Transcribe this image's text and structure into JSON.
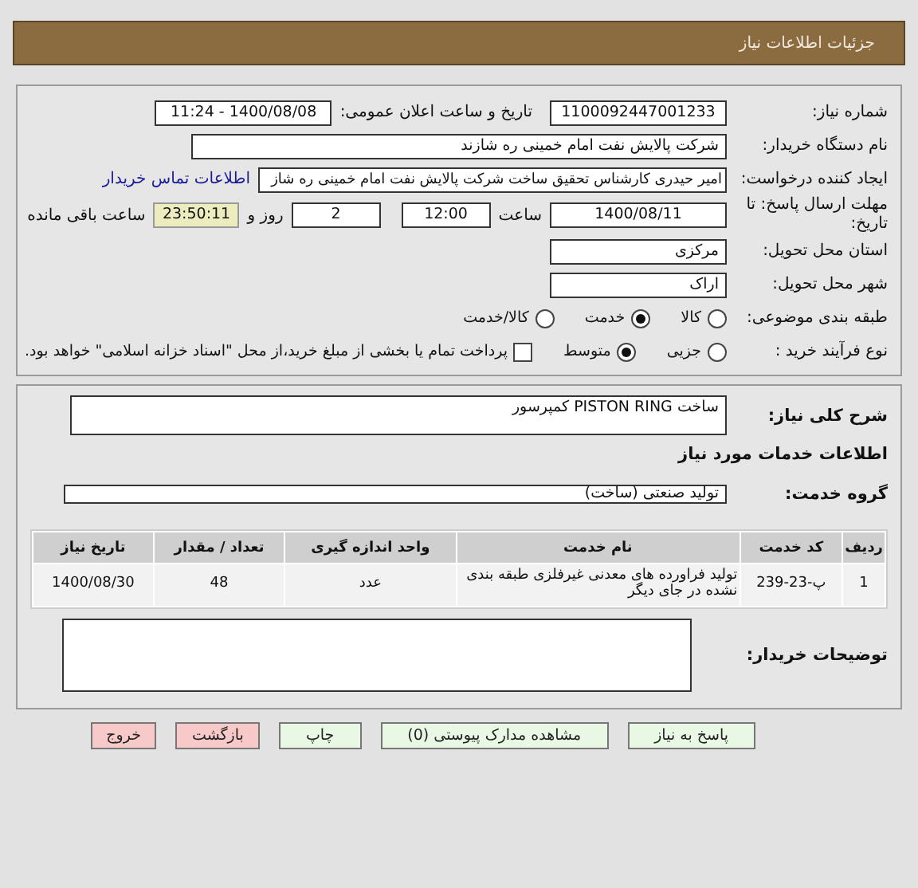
{
  "header": {
    "title": "جزئیات اطلاعات نیاز"
  },
  "need_number": {
    "label": "شماره نیاز:",
    "value": "1100092447001233"
  },
  "announce": {
    "label": "تاریخ و ساعت اعلان عمومی:",
    "value": "1400/08/08 - 11:24"
  },
  "buyer": {
    "label": "نام دستگاه خریدار:",
    "value": "شرکت پالایش نفت امام خمینی  ره  شازند"
  },
  "creator": {
    "label": "ایجاد کننده درخواست:",
    "value": "امیر  حیدری کارشناس تحقیق ساخت شرکت پالایش نفت امام خمینی  ره  شاز",
    "link": "اطلاعات تماس خریدار"
  },
  "deadline": {
    "label": "مهلت ارسال پاسخ: تا تاریخ:",
    "date": "1400/08/11",
    "time_label": "ساعت",
    "time": "12:00",
    "days": "2",
    "days_label": "روز و",
    "remaining": "23:50:11",
    "remaining_label": "ساعت باقی مانده"
  },
  "province": {
    "label": "استان محل تحویل:",
    "value": "مرکزی"
  },
  "city": {
    "label": "شهر محل تحویل:",
    "value": "اراک"
  },
  "category": {
    "label": "طبقه بندی موضوعی:",
    "options": [
      {
        "label": "کالا",
        "selected": false
      },
      {
        "label": "خدمت",
        "selected": true
      },
      {
        "label": "کالا/خدمت",
        "selected": false
      }
    ]
  },
  "process": {
    "label": "نوع فرآیند خرید :",
    "options": [
      {
        "label": "جزیی",
        "selected": false
      },
      {
        "label": "متوسط",
        "selected": true
      }
    ],
    "treasury": {
      "label": "پرداخت تمام یا بخشی از مبلغ خرید،از محل \"اسناد خزانه اسلامی\" خواهد بود.",
      "checked": false
    }
  },
  "description": {
    "label": "شرح کلی نیاز:",
    "value": "ساخت PISTON RING  کمپرسور"
  },
  "services_heading": "اطلاعات خدمات مورد نیاز",
  "service_group": {
    "label": "گروه خدمت:",
    "value": "تولید صنعتی (ساخت)"
  },
  "table": {
    "columns": [
      "ردیف",
      "کد خدمت",
      "نام خدمت",
      "واحد اندازه گیری",
      "تعداد / مقدار",
      "تاریخ نیاز"
    ],
    "rows": [
      [
        "1",
        "پ-23-239",
        "تولید فراورده های معدنی غیرفلزی طبقه بندی نشده در جای دیگر",
        "عدد",
        "48",
        "1400/08/30"
      ]
    ]
  },
  "buyer_notes": {
    "label": "توضیحات خریدار:"
  },
  "buttons": [
    {
      "label": "پاسخ به نیاز",
      "kind": "normal"
    },
    {
      "label": "مشاهده مدارک پیوستی (0)",
      "kind": "normal"
    },
    {
      "label": "چاپ",
      "kind": "normal"
    },
    {
      "label": "بازگشت",
      "kind": "exit"
    },
    {
      "label": "خروج",
      "kind": "exit"
    }
  ]
}
